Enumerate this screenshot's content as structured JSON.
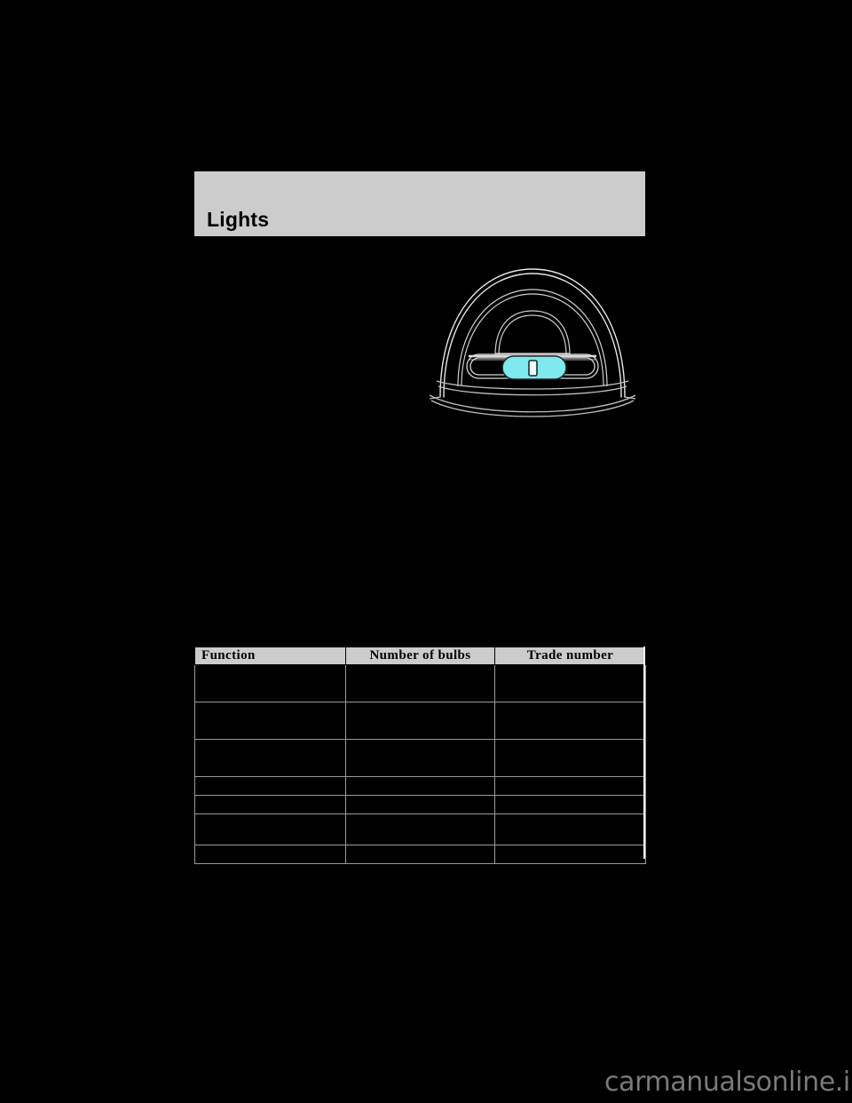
{
  "page": {
    "background_color": "#000000",
    "band_color": "#cccccc",
    "bulb_highlight_color": "#7fe8ee"
  },
  "section": {
    "title": "Lights"
  },
  "illustration": {
    "name": "dome-lamp-bulb-replacement-diagram",
    "caption": ""
  },
  "body": {
    "left_column": "",
    "full_width": "",
    "note": ""
  },
  "bulb_table": {
    "columns": [
      "Function",
      "Number of bulbs",
      "Trade number"
    ],
    "rows": [
      {
        "function": "",
        "count": "",
        "trade": "",
        "height": "tall"
      },
      {
        "function": "",
        "count": "",
        "trade": "",
        "height": "tall"
      },
      {
        "function": "",
        "count": "",
        "trade": "",
        "height": "tall"
      },
      {
        "function": "",
        "count": "",
        "trade": "",
        "height": "short"
      },
      {
        "function": "",
        "count": "",
        "trade": "",
        "height": "short"
      },
      {
        "function": "",
        "count": "",
        "trade": "",
        "height": "mid"
      },
      {
        "function": "",
        "count": "",
        "trade": "",
        "height": "short"
      }
    ]
  },
  "watermark": {
    "text": "carmanualsonline.info"
  }
}
